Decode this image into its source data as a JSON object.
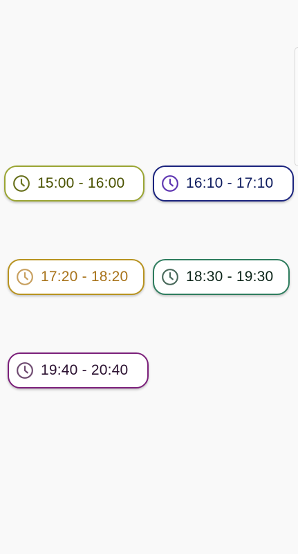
{
  "slots": [
    {
      "label": "15:00 - 16:00",
      "icon": "clock-icon",
      "border_color": "#9aa533",
      "text_color": "#4a5200",
      "icon_color": "#6b7320"
    },
    {
      "label": "16:10 - 17:10",
      "icon": "clock-icon",
      "border_color": "#1a237e",
      "text_color": "#0d1b5e",
      "icon_color": "#5e35b1"
    },
    {
      "label": "17:20 - 18:20",
      "icon": "clock-icon",
      "border_color": "#b89320",
      "text_color": "#a8731a",
      "icon_color": "#c8a060"
    },
    {
      "label": "18:30 - 19:30",
      "icon": "clock-icon",
      "border_color": "#2e7d5e",
      "text_color": "#0b2418",
      "icon_color": "#4a6a5c"
    },
    {
      "label": "19:40 - 20:40",
      "icon": "clock-icon",
      "border_color": "#7b1f7a",
      "text_color": "#2a1030",
      "icon_color": "#6e4a70"
    }
  ]
}
